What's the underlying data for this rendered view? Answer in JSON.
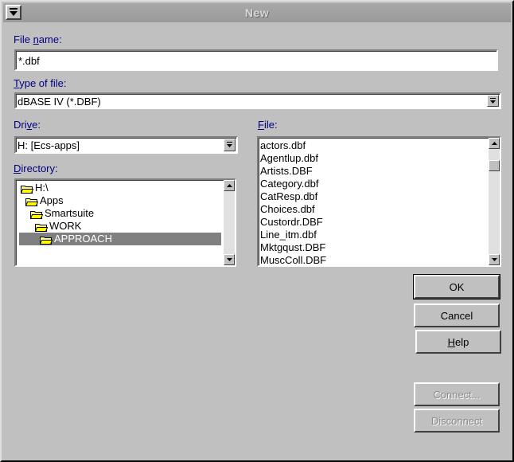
{
  "window": {
    "title": "New"
  },
  "file_name": {
    "label_pre": "File ",
    "label_u": "n",
    "label_post": "ame:",
    "value": "*.dbf"
  },
  "type_of_file": {
    "label_u": "T",
    "label_post": "ype of file:",
    "value": "dBASE IV (*.DBF)"
  },
  "drive": {
    "label_pre": "Dri",
    "label_u": "v",
    "label_post": "e:",
    "value": "H:  [Ecs-apps]"
  },
  "directory": {
    "label_u": "D",
    "label_post": "irectory:",
    "items": [
      {
        "label": "H:\\"
      },
      {
        "label": "Apps"
      },
      {
        "label": "Smartsuite"
      },
      {
        "label": "WORK"
      },
      {
        "label": "APPROACH"
      }
    ]
  },
  "file": {
    "label_u": "F",
    "label_post": "ile:",
    "items": [
      "actors.dbf",
      "Agentlup.dbf",
      "Artists.DBF",
      "Category.dbf",
      "CatResp.dbf",
      "Choices.dbf",
      "Custordr.DBF",
      "Line_itm.dbf",
      "Mktgqust.DBF",
      "MuscColl.DBF"
    ]
  },
  "buttons": {
    "ok": "OK",
    "cancel": "Cancel",
    "help_u": "H",
    "help_post": "elp",
    "connect": "Connect...",
    "disconnect": "Disconnect"
  }
}
